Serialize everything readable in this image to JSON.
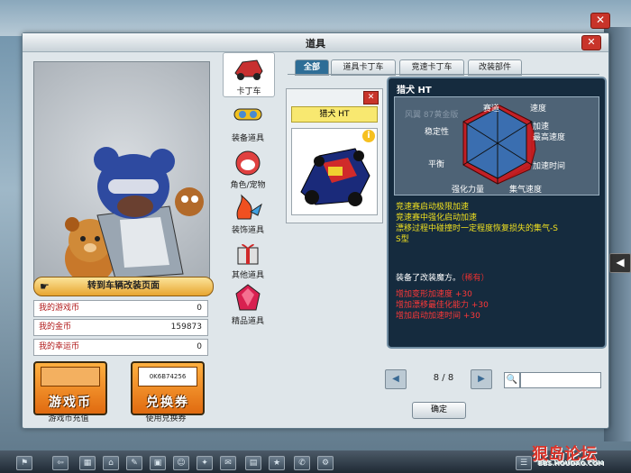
{
  "window": {
    "title": "道具",
    "close": "✕"
  },
  "outer_close": "✕",
  "side_arrow": "◀",
  "character": {
    "button_label": "转到车辆改装页面"
  },
  "stats": [
    {
      "label": "我的游戏币",
      "value": "0"
    },
    {
      "label": "我的金币",
      "value": "159873"
    },
    {
      "label": "我的幸运币",
      "value": "0"
    }
  ],
  "buttons": {
    "recharge": {
      "label": "游戏币",
      "caption": "游戏币充值"
    },
    "voucher": {
      "label": "兑换券",
      "caption": "使用兑换券",
      "code": "0K6B74256"
    }
  },
  "categories": [
    {
      "label": "卡丁车"
    },
    {
      "label": "装备道具"
    },
    {
      "label": "角色/宠物"
    },
    {
      "label": "装饰道具"
    },
    {
      "label": "其他道具"
    },
    {
      "label": "精品道具"
    }
  ],
  "tabs": [
    "全部",
    "道具卡丁车",
    "竞速卡丁车",
    "改装部件"
  ],
  "item": {
    "name": "猎犬 HT",
    "close": "✕",
    "info": "i"
  },
  "tooltip": {
    "name": "猎犬 HT",
    "ghost_text": "风翼 87黄金版",
    "radar_labels": [
      "赛道",
      "速度",
      "稳定性",
      "加速",
      "最高速度",
      "平衡",
      "加速时间",
      "强化力量",
      "集气速度"
    ],
    "features": [
      "竞速赛启动极限加速",
      "竞速赛中强化启动加速",
      "漂移过程中碰撞时一定程度恢复损失的集气-S",
      "S型"
    ],
    "modified_prefix": "装备了改装魔方。",
    "modified_rare": "（稀有）",
    "bonuses": [
      "增加变形加速度 +30",
      "增加漂移最佳化能力 +30",
      "增加启动加速时间 +30"
    ]
  },
  "pagination": {
    "text": "8 / 8",
    "prev": "◀",
    "next": "▶"
  },
  "search": {
    "icon": "🔍"
  },
  "ok": "确定",
  "watermark": {
    "main": "狠岛论坛",
    "sub": "BBS.HOUDAO.COM"
  }
}
